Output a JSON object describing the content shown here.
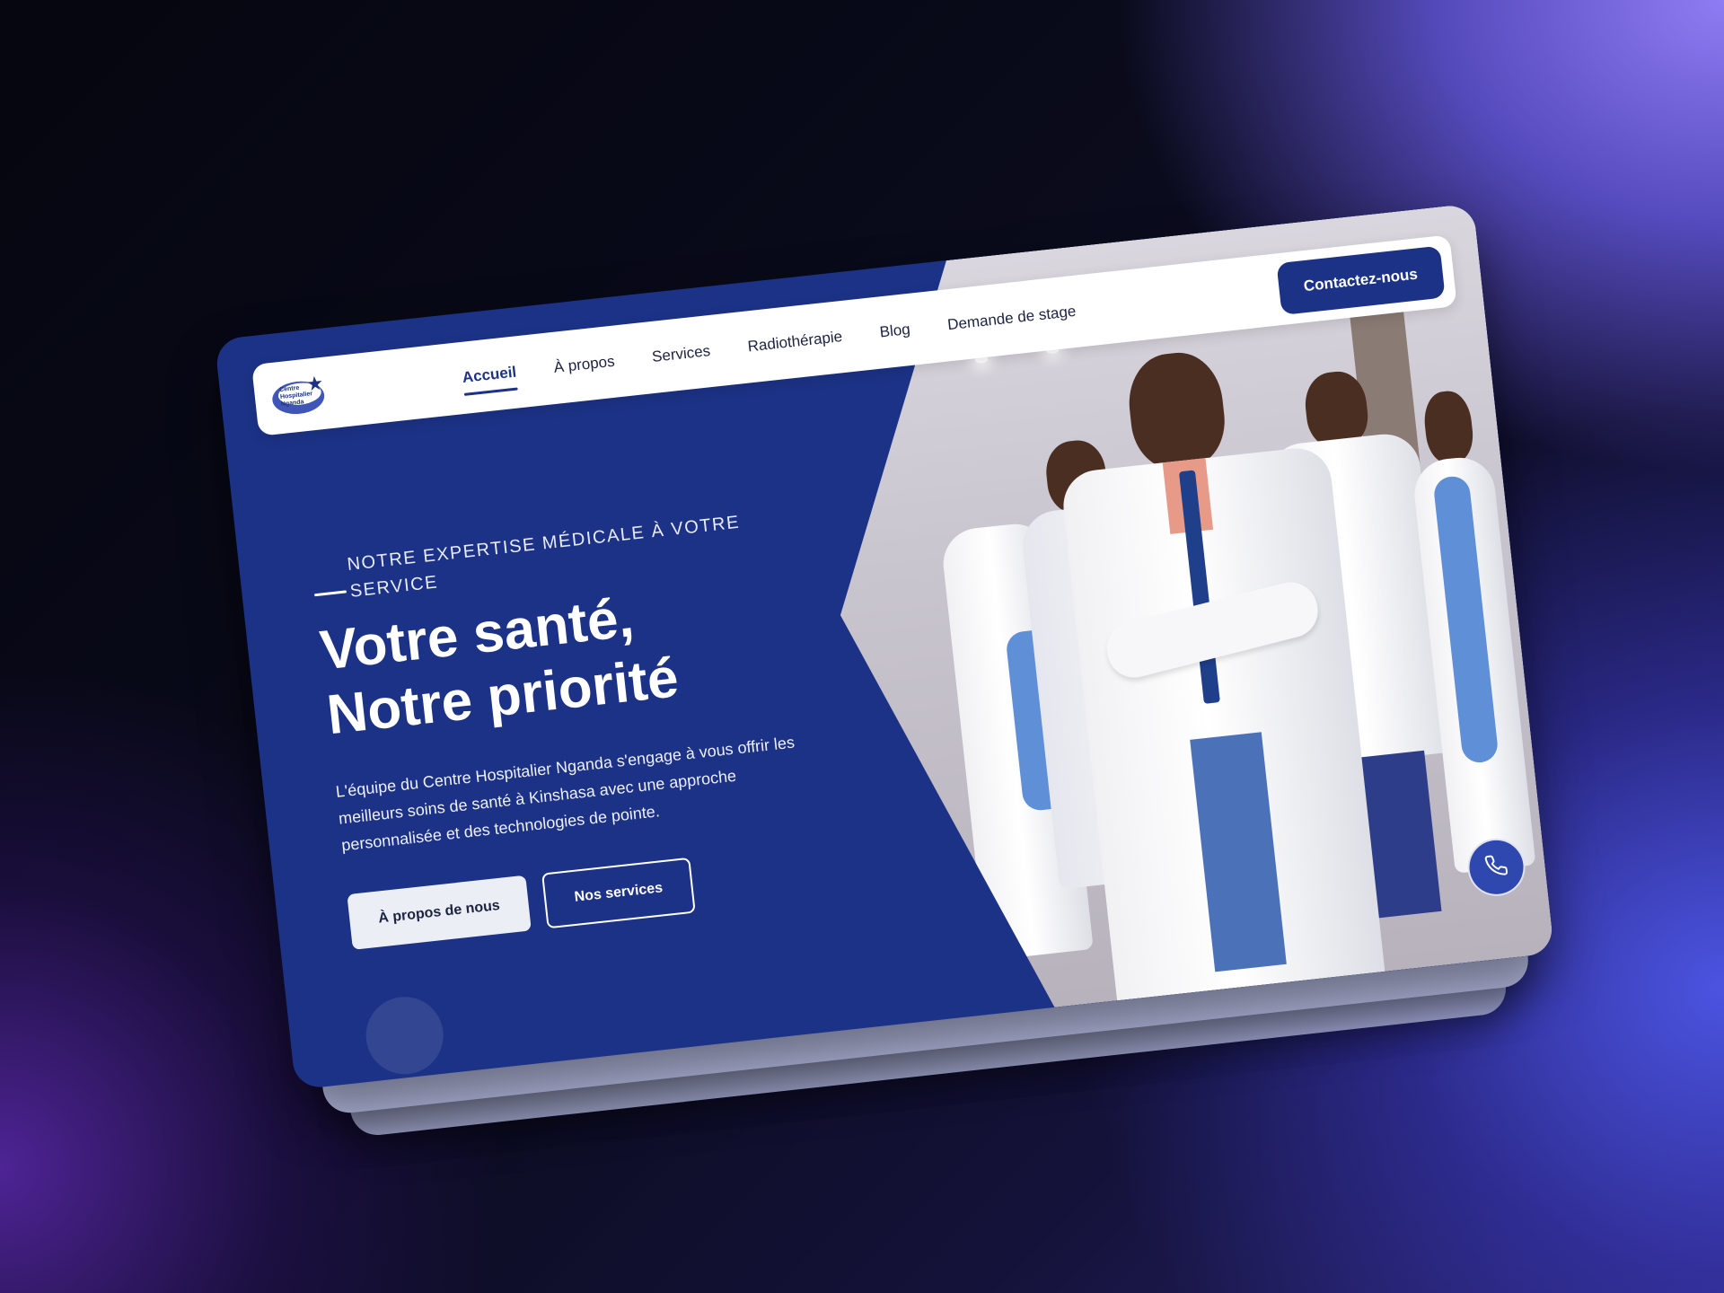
{
  "brand": {
    "logo_text_line1": "Centre",
    "logo_text_line2": "Hospitalier",
    "logo_text_line3": "Nganda",
    "primary_color": "#1c3286"
  },
  "nav": {
    "items": [
      {
        "label": "Accueil",
        "active": true
      },
      {
        "label": "À propos",
        "active": false
      },
      {
        "label": "Services",
        "active": false
      },
      {
        "label": "Radiothérapie",
        "active": false
      },
      {
        "label": "Blog",
        "active": false
      },
      {
        "label": "Demande de stage",
        "active": false
      }
    ],
    "cta_label": "Contactez-nous"
  },
  "hero": {
    "eyebrow": "NOTRE EXPERTISE MÉDICALE À VOTRE SERVICE",
    "headline_line1": "Votre santé,",
    "headline_line2": "Notre priorité",
    "lead": "L'équipe du Centre Hospitalier Nganda s'engage à vous offrir les meilleurs soins de santé à Kinshasa avec une approche personnalisée et des technologies de pointe.",
    "primary_button": "À propos de nous",
    "secondary_button": "Nos services"
  },
  "floating": {
    "phone_icon": "phone-icon"
  }
}
